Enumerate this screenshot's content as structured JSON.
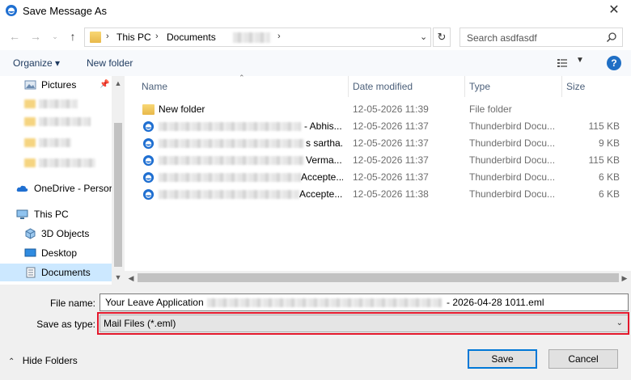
{
  "window": {
    "title": "Save Message As",
    "close": "✕"
  },
  "address": {
    "segments": [
      "This PC",
      "Documents"
    ]
  },
  "search": {
    "placeholder": "Search asdfasdf"
  },
  "toolbar": {
    "organize": "Organize ▾",
    "new_folder": "New folder",
    "help": "?"
  },
  "nav": {
    "items": [
      {
        "label": "Pictures"
      },
      {
        "label": "OneDrive - Persor"
      },
      {
        "label": "This PC"
      },
      {
        "label": "3D Objects"
      },
      {
        "label": "Desktop"
      },
      {
        "label": "Documents"
      }
    ]
  },
  "columns": {
    "name": "Name",
    "date": "Date modified",
    "type": "Type",
    "size": "Size"
  },
  "files": [
    {
      "icon": "folder-icon",
      "name": "New folder",
      "date": "12-05-2026 11:39",
      "type": "File folder",
      "size": ""
    },
    {
      "icon": "thunderbird-icon",
      "name": "- Abhis...",
      "date": "12-05-2026 11:37",
      "type": "Thunderbird Docu...",
      "size": "115 KB"
    },
    {
      "icon": "thunderbird-icon",
      "name": "s sartha...",
      "date": "12-05-2026 11:37",
      "type": "Thunderbird Docu...",
      "size": "9 KB"
    },
    {
      "icon": "thunderbird-icon",
      "name": "Verma...",
      "date": "12-05-2026 11:37",
      "type": "Thunderbird Docu...",
      "size": "115 KB"
    },
    {
      "icon": "thunderbird-icon",
      "name": "Accepte...",
      "date": "12-05-2026 11:37",
      "type": "Thunderbird Docu...",
      "size": "6 KB"
    },
    {
      "icon": "thunderbird-icon",
      "name": "Accepte...",
      "date": "12-05-2026 11:38",
      "type": "Thunderbird Docu...",
      "size": "6 KB"
    }
  ],
  "form": {
    "file_name_label": "File name:",
    "file_name_prefix": "Your Leave Application",
    "file_name_suffix": "- 2026-04-28 1011.eml",
    "save_type_label": "Save as type:",
    "save_type_value": "Mail Files (*.eml)"
  },
  "footer": {
    "hide_folders": "Hide Folders",
    "save": "Save",
    "cancel": "Cancel"
  },
  "colors": {
    "accent": "#0078d7",
    "highlight": "#e3172b",
    "selection": "#cce8ff"
  }
}
